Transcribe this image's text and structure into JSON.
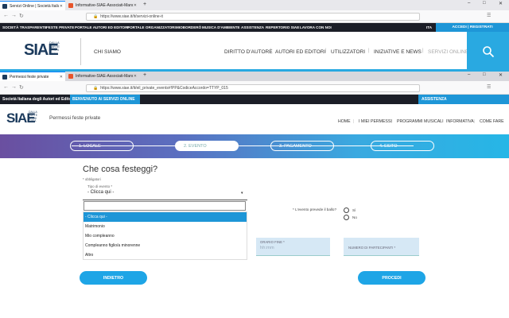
{
  "browser1": {
    "tabs": [
      {
        "title": "Servizi Online | Società Italiana de...",
        "active": true
      },
      {
        "title": "Informative-SIAE-Associati-Mandan...",
        "active": false
      }
    ],
    "new_tab": "+",
    "url": "https://www.siae.it/it/servizi-online-it",
    "window_controls": [
      "–",
      "□",
      "✕"
    ]
  },
  "site1": {
    "topnav": [
      "SOCIETÀ TRASPARENTE",
      "FESTE PRIVATE",
      "PORTALE AUTORI ED EDITORI",
      "PORTALE ORGANIZZATORI",
      "MIOBORDERÒ",
      "MUSICA D'AMBIENTE",
      "ASSISTENZA",
      "REPERTORIO SIAE",
      "LAVORA CON NOI"
    ],
    "lang": "ITA",
    "register": "ACCEDI | REGISTRATI",
    "logo": "SIAE",
    "logo_tagline": [
      "DALLA",
      "PARTE",
      "DI CHI",
      "CREA"
    ],
    "chi_siamo": "CHI SIAMO",
    "menu": [
      "DIRITTO D'AUTORE",
      "AUTORI ED EDITORI",
      "UTILIZZATORI",
      "INIZIATIVE E NEWS",
      "SERVIZI ONLINE"
    ]
  },
  "browser2": {
    "tabs": [
      {
        "title": "Permessi feste private",
        "active": true
      },
      {
        "title": "Informative-SIAE-Associati-Mandan...",
        "active": false
      }
    ],
    "url": "https://www.siae.it/it/eil_private_events#!PP&CodiceAccordo=TTYP_015"
  },
  "site2": {
    "topbar": "Società Italiana degli Autori ed Editori",
    "welcome": "BENVENUTO AI SERVIZI ONLINE",
    "assist": "ASSISTENZA",
    "page_title": "Permessi feste private",
    "menu": [
      "HOME",
      "I MIEI PERMESSI",
      "PROGRAMMI MUSICALI",
      "INFORMATIVA",
      "COME FARE"
    ],
    "steps": [
      "1. LOCALE",
      "2. EVENTO",
      "3. PAGAMENTO",
      "4. ESITO"
    ],
    "active_step": 1
  },
  "form": {
    "heading": "Che cosa festeggi?",
    "required_note": "* obbligatori",
    "select_label": "Tipo di evento *",
    "select_value": "- Clicca qui -",
    "options": [
      "- Clicca qui -",
      "Matrimonio",
      "Mio compleanno",
      "Compleanno figlio/a minorenne",
      "Altro"
    ],
    "highlighted_option": 0,
    "question": "* L'evento prevede il ballo?",
    "radio": [
      "Sì",
      "No"
    ],
    "end_time_label": "ORARIO FINE *",
    "end_time_placeholder": "hh:mm",
    "participants_label": "NUMERO DI PARTECIPANTI *",
    "back_button": "INDIETRO",
    "next_button": "PROCEDI"
  },
  "colors": {
    "accent": "#1e96d7",
    "dark_bar": "#1b1e27",
    "field_bg": "#d6e8f5"
  }
}
